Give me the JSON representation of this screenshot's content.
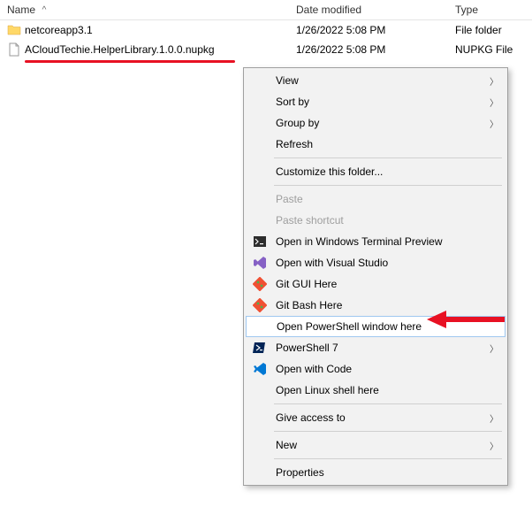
{
  "columns": {
    "name": "Name",
    "date": "Date modified",
    "type": "Type"
  },
  "files": [
    {
      "name": "netcoreapp3.1",
      "date": "1/26/2022 5:08 PM",
      "type": "File folder",
      "icon": "folder"
    },
    {
      "name": "ACloudTechie.HelperLibrary.1.0.0.nupkg",
      "date": "1/26/2022 5:08 PM",
      "type": "NUPKG File",
      "icon": "file"
    }
  ],
  "menu": {
    "view": "View",
    "sortby": "Sort by",
    "groupby": "Group by",
    "refresh": "Refresh",
    "customize": "Customize this folder...",
    "paste": "Paste",
    "paste_shortcut": "Paste shortcut",
    "open_terminal": "Open in Windows Terminal Preview",
    "open_vs": "Open with Visual Studio",
    "git_gui": "Git GUI Here",
    "git_bash": "Git Bash Here",
    "open_ps_here": "Open PowerShell window here",
    "ps7": "PowerShell 7",
    "open_code": "Open with Code",
    "open_linux": "Open Linux shell here",
    "give_access": "Give access to",
    "new": "New",
    "properties": "Properties"
  }
}
